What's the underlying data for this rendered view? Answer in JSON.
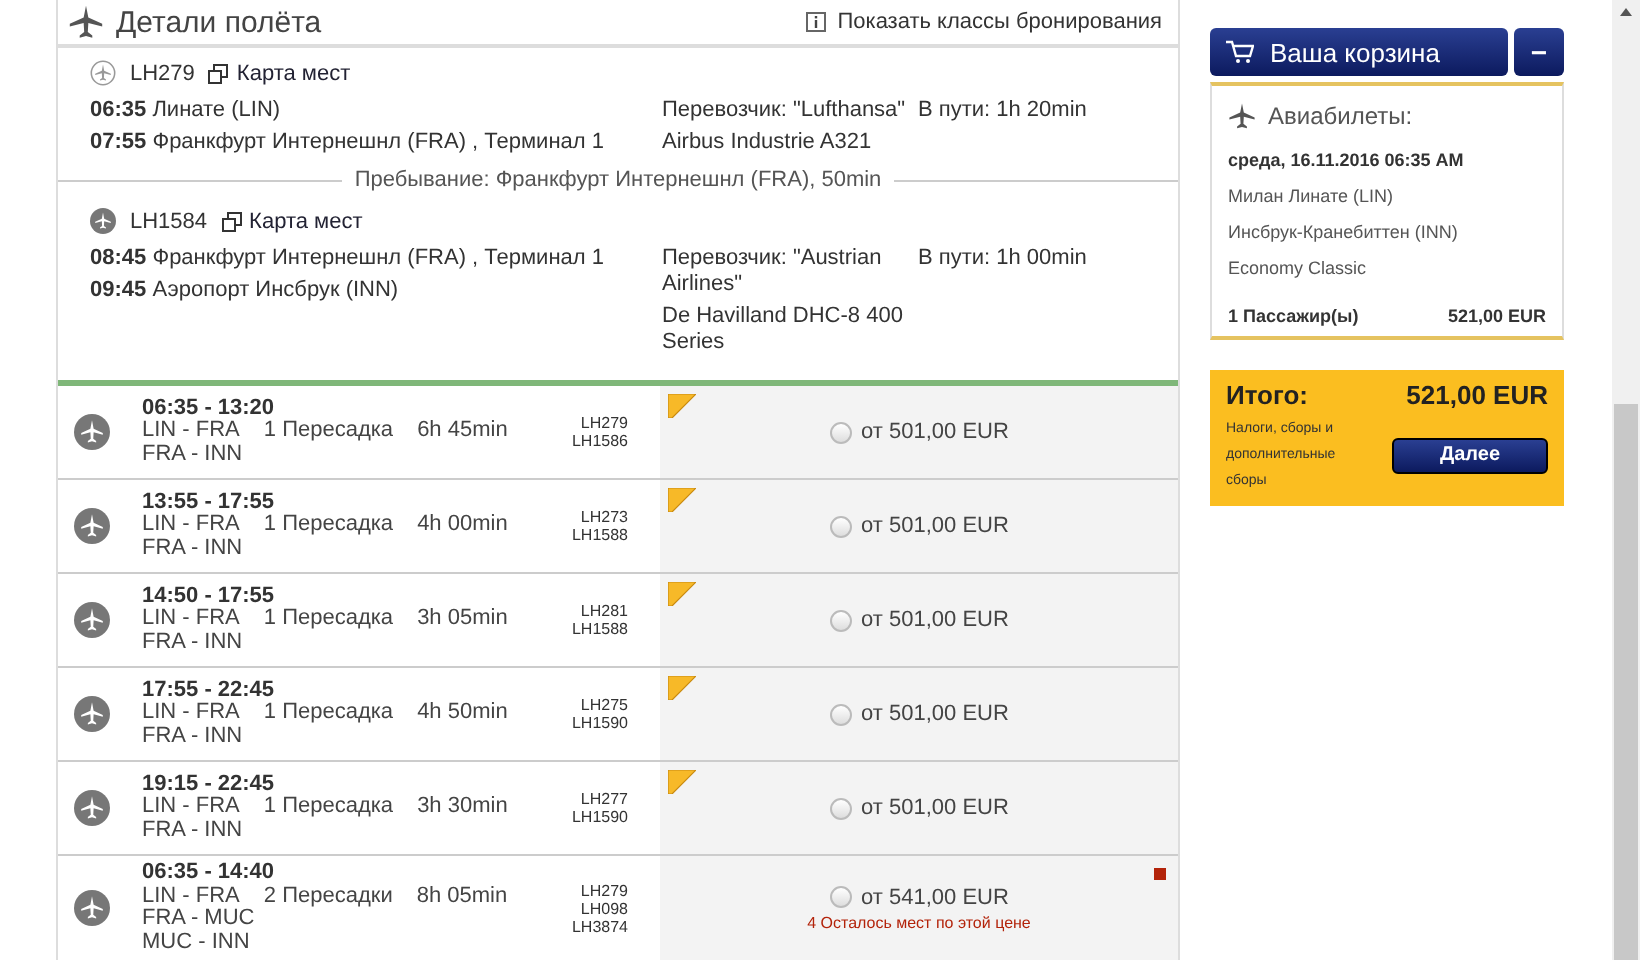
{
  "details": {
    "title": "Детали полёта",
    "booking_classes_link": "Показать классы бронирования",
    "segments": [
      {
        "kind": "outline",
        "flight": "LH279",
        "seat_map": "Карта мест",
        "dep_time": "06:35",
        "dep_place": "Линате (LIN)",
        "arr_time": "07:55",
        "arr_place": "Франкфурт Интернешнл (FRA) , Терминал 1",
        "carrier": "Перевозчик: \"Lufthansa\"",
        "aircraft": "Airbus Industrie A321",
        "duration": "В пути: 1h 20min"
      },
      {
        "kind": "filled",
        "flight": "LH1584",
        "seat_map": "Карта мест",
        "dep_time": "08:45",
        "dep_place": "Франкфурт Интернешнл (FRA) , Терминал 1",
        "arr_time": "09:45",
        "arr_place": "Аэропорт Инсбрук (INN)",
        "carrier": "Перевозчик: \"Austrian Airlines\"",
        "aircraft": "De Havilland DHC-8 400 Series",
        "duration": "В пути: 1h 00min"
      }
    ],
    "layover": "Пребывание: Франкфурт Интернешнл (FRA), 50min"
  },
  "flights": [
    {
      "times": "06:35 - 13:20",
      "routes": [
        "LIN - FRA",
        "FRA - INN"
      ],
      "stops": "1 Пересадка",
      "duration": "6h 45min",
      "codes": [
        "LH279",
        "LH1586"
      ],
      "tagged": true,
      "selected": false,
      "price": "от 501,00 EUR",
      "warning": false
    },
    {
      "times": "13:55 - 17:55",
      "routes": [
        "LIN - FRA",
        "FRA - INN"
      ],
      "stops": "1 Пересадка",
      "duration": "4h 00min",
      "codes": [
        "LH273",
        "LH1588"
      ],
      "tagged": true,
      "selected": false,
      "price": "от 501,00 EUR",
      "warning": false
    },
    {
      "times": "14:50 - 17:55",
      "routes": [
        "LIN - FRA",
        "FRA - INN"
      ],
      "stops": "1 Пересадка",
      "duration": "3h 05min",
      "codes": [
        "LH281",
        "LH1588"
      ],
      "tagged": true,
      "selected": false,
      "price": "от 501,00 EUR",
      "warning": false
    },
    {
      "times": "17:55 - 22:45",
      "routes": [
        "LIN - FRA",
        "FRA - INN"
      ],
      "stops": "1 Пересадка",
      "duration": "4h 50min",
      "codes": [
        "LH275",
        "LH1590"
      ],
      "tagged": true,
      "selected": false,
      "price": "от 501,00 EUR",
      "warning": false
    },
    {
      "times": "19:15 - 22:45",
      "routes": [
        "LIN - FRA",
        "FRA - INN"
      ],
      "stops": "1 Пересадка",
      "duration": "3h 30min",
      "codes": [
        "LH277",
        "LH1590"
      ],
      "tagged": true,
      "selected": false,
      "price": "от 501,00 EUR",
      "warning": false
    },
    {
      "times": "06:35 - 14:40",
      "routes": [
        "LIN - FRA",
        "FRA - MUC",
        "MUC - INN"
      ],
      "stops": "2 Пересадки",
      "duration": "8h 05min",
      "codes": [
        "LH279",
        "LH098",
        "LH3874"
      ],
      "tagged": false,
      "selected": false,
      "price": "от 541,00 EUR",
      "warning": true,
      "note": "4 Осталось мест по этой цене"
    }
  ],
  "cart": {
    "title": "Ваша корзина",
    "collapse": "−",
    "section": "Авиабилеты:",
    "date": "среда, 16.11.2016 06:35 AM",
    "from": "Милан Линате (LIN)",
    "to": "Инсбрук-Кранебиттен (INN)",
    "class": "Economy Classic",
    "passengers": "1 Пассажир(ы)",
    "subtotal": "521,00 EUR",
    "total_label": "Итого:",
    "total": "521,00 EUR",
    "fees": "Налоги, сборы и дополнительные сборы",
    "next": "Далее"
  }
}
